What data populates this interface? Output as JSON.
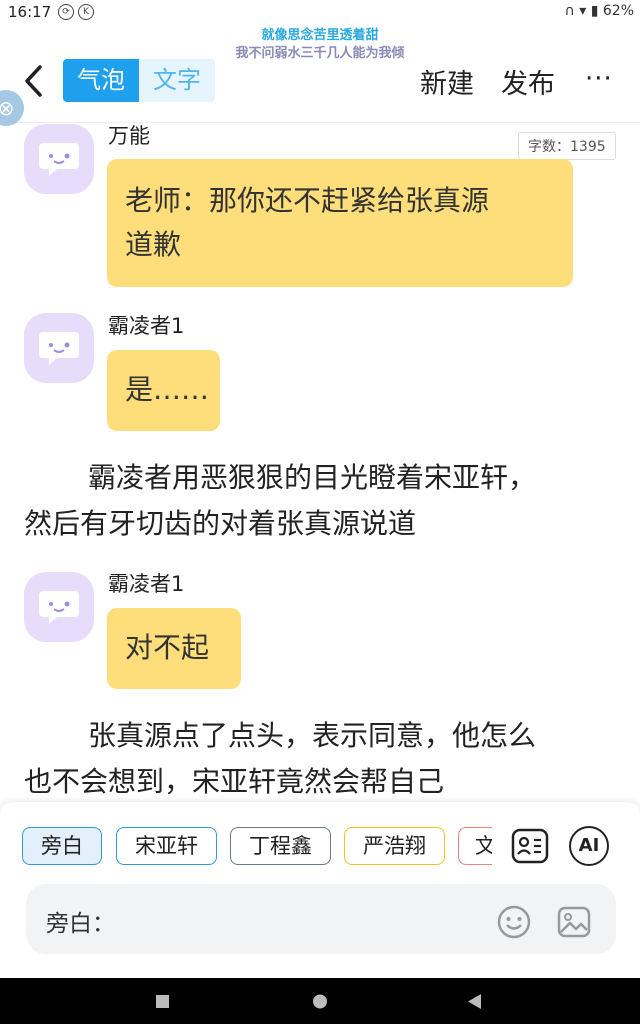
{
  "status_bar": {
    "time": "16:17",
    "battery": "62%"
  },
  "overlay": {
    "lyric_line1": "就像思念苦里透着甜",
    "lyric_line2": "我不问弱水三千几人能为我倾"
  },
  "header": {
    "tabs": [
      {
        "label": "气泡"
      },
      {
        "label": "文字"
      }
    ],
    "new_label": "新建",
    "publish_label": "发布",
    "more_label": "···"
  },
  "word_count": "字数：1395",
  "messages": [
    {
      "name": "万能",
      "text_line1": "老师：那你还不赶紧给张真源",
      "text_line2": "道歉"
    },
    {
      "name": "霸凌者1",
      "text": "是……"
    },
    {
      "narration_line1": "霸凌者用恶狠狠的目光瞪着宋亚轩，",
      "narration_line2": "然后有牙切齿的对着张真源说道"
    },
    {
      "name": "霸凌者1",
      "text": "对不起"
    },
    {
      "narration_line1": "张真源点了点头，表示同意，他怎么",
      "narration_line2": "也不会想到，宋亚轩竟然会帮自己"
    }
  ],
  "roles": [
    "旁白",
    "宋亚轩",
    "丁程鑫",
    "严浩翔",
    "文"
  ],
  "ai_label": "AI",
  "input": {
    "label": "旁白："
  },
  "colors": {
    "accent": "#1ea0ee",
    "bubble": "#fede7a",
    "avatar_bg": "#e7dcf9"
  }
}
